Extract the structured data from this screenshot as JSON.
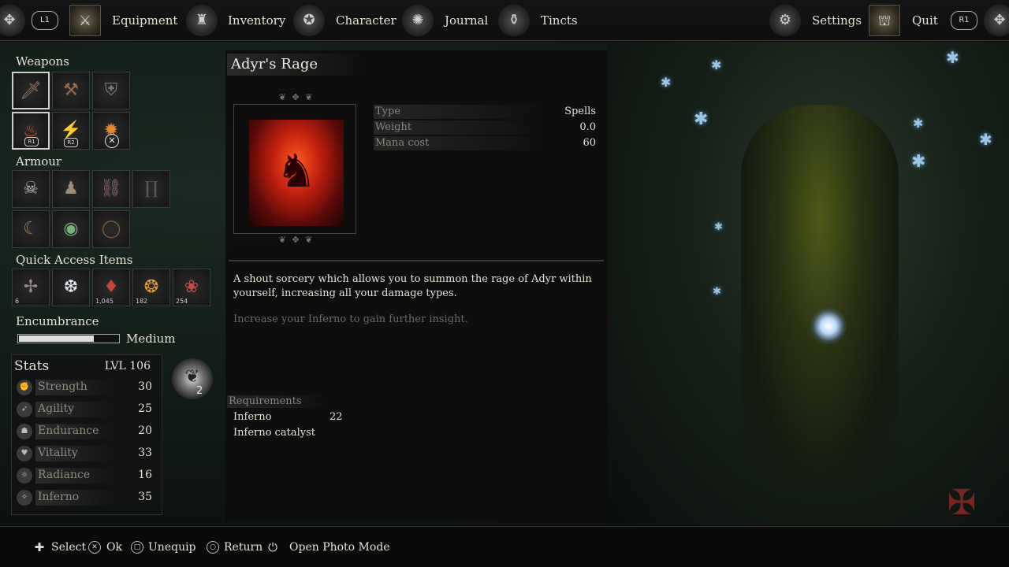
{
  "topbar": {
    "left_bumper": "L1",
    "right_bumper": "R1",
    "tabs": [
      {
        "label": "Equipment"
      },
      {
        "label": "Inventory"
      },
      {
        "label": "Character"
      },
      {
        "label": "Journal"
      },
      {
        "label": "Tincts"
      }
    ],
    "settings_label": "Settings",
    "quit_label": "Quit"
  },
  "loadout": {
    "weapons_title": "Weapons",
    "weapon_badges": {
      "right_hand": "R1",
      "left_hand": "R2"
    },
    "armour_title": "Armour",
    "quick_access_title": "Quick Access Items",
    "quick_items": [
      {
        "count": "6"
      },
      {
        "count": ""
      },
      {
        "count": "1,045"
      },
      {
        "count": "182"
      },
      {
        "count": "254"
      }
    ],
    "encumbrance_title": "Encumbrance",
    "encumbrance_level": "Medium",
    "encumbrance_fraction": 0.75
  },
  "stats": {
    "title": "Stats",
    "level": "LVL 106",
    "rows": [
      {
        "name": "Strength",
        "value": "30"
      },
      {
        "name": "Agility",
        "value": "25"
      },
      {
        "name": "Endurance",
        "value": "20"
      },
      {
        "name": "Vitality",
        "value": "33"
      },
      {
        "name": "Radiance",
        "value": "16"
      },
      {
        "name": "Inferno",
        "value": "35"
      }
    ],
    "points_available": "2"
  },
  "item": {
    "name": "Adyr's Rage",
    "properties": [
      {
        "key": "Type",
        "value": "Spells"
      },
      {
        "key": "Weight",
        "value": "0.0"
      },
      {
        "key": "Mana cost",
        "value": "60"
      }
    ],
    "description": "A shout sorcery which allows you to summon the rage of Adyr within yourself, increasing all your damage types.",
    "hint": "Increase your Inferno to gain further insight.",
    "requirements_title": "Requirements",
    "requirements": [
      {
        "name": "Inferno",
        "value": "22"
      },
      {
        "name": "Inferno catalyst",
        "value": ""
      }
    ]
  },
  "bottombar": {
    "select_label": "Select",
    "ok_label": "Ok",
    "unequip_label": "Unequip",
    "return_label": "Return",
    "photo_label": "Open Photo Mode"
  }
}
